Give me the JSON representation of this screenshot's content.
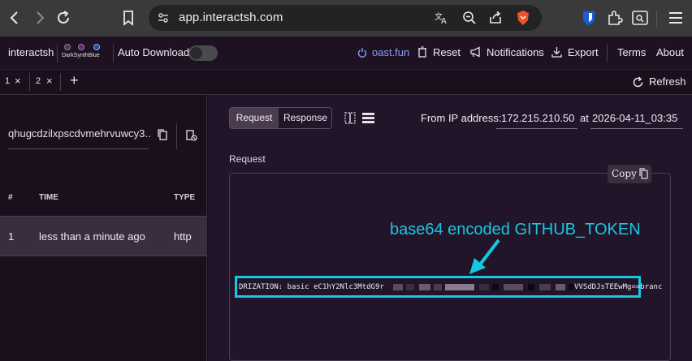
{
  "browser": {
    "url": "app.interactsh.com"
  },
  "header": {
    "brand": "interactsh",
    "theme_label": "DarkSynthBlue",
    "auto_download": "Auto Download",
    "server": "oast.fun",
    "reset": "Reset",
    "notifications": "Notifications",
    "export": "Export",
    "terms": "Terms",
    "about": "About"
  },
  "tabs": {
    "items": [
      {
        "label": "1"
      },
      {
        "label": "2"
      }
    ],
    "refresh": "Refresh"
  },
  "sidebar": {
    "interaction_id": "qhugcdzilxpscdvmehrvuwcy3...",
    "columns": [
      "#",
      "TIME",
      "TYPE"
    ],
    "rows": [
      {
        "num": "1",
        "time": "less than a minute ago",
        "type": "http"
      }
    ]
  },
  "detail": {
    "view_tabs": [
      "Request",
      "Response"
    ],
    "from_ip_label": "From IP address:",
    "ip": "172.215.210.50",
    "at_label": "at",
    "timestamp": "2026-04-11_03:35",
    "section_title": "Request",
    "copy_label": "Copy",
    "auth_prefix": "DRIZATION: basic eC1hY2Nlc3MtdG9r",
    "auth_suffix": "VVSdDJsTEEwMg==branc",
    "annotation": "base64 encoded GITHUB_TOKEN"
  },
  "colors": {
    "accent": "#16c8e0",
    "selected_row": "#3a2d3d",
    "brave_orange": "#f0502a",
    "bitwarden_blue": "#175ddc"
  }
}
